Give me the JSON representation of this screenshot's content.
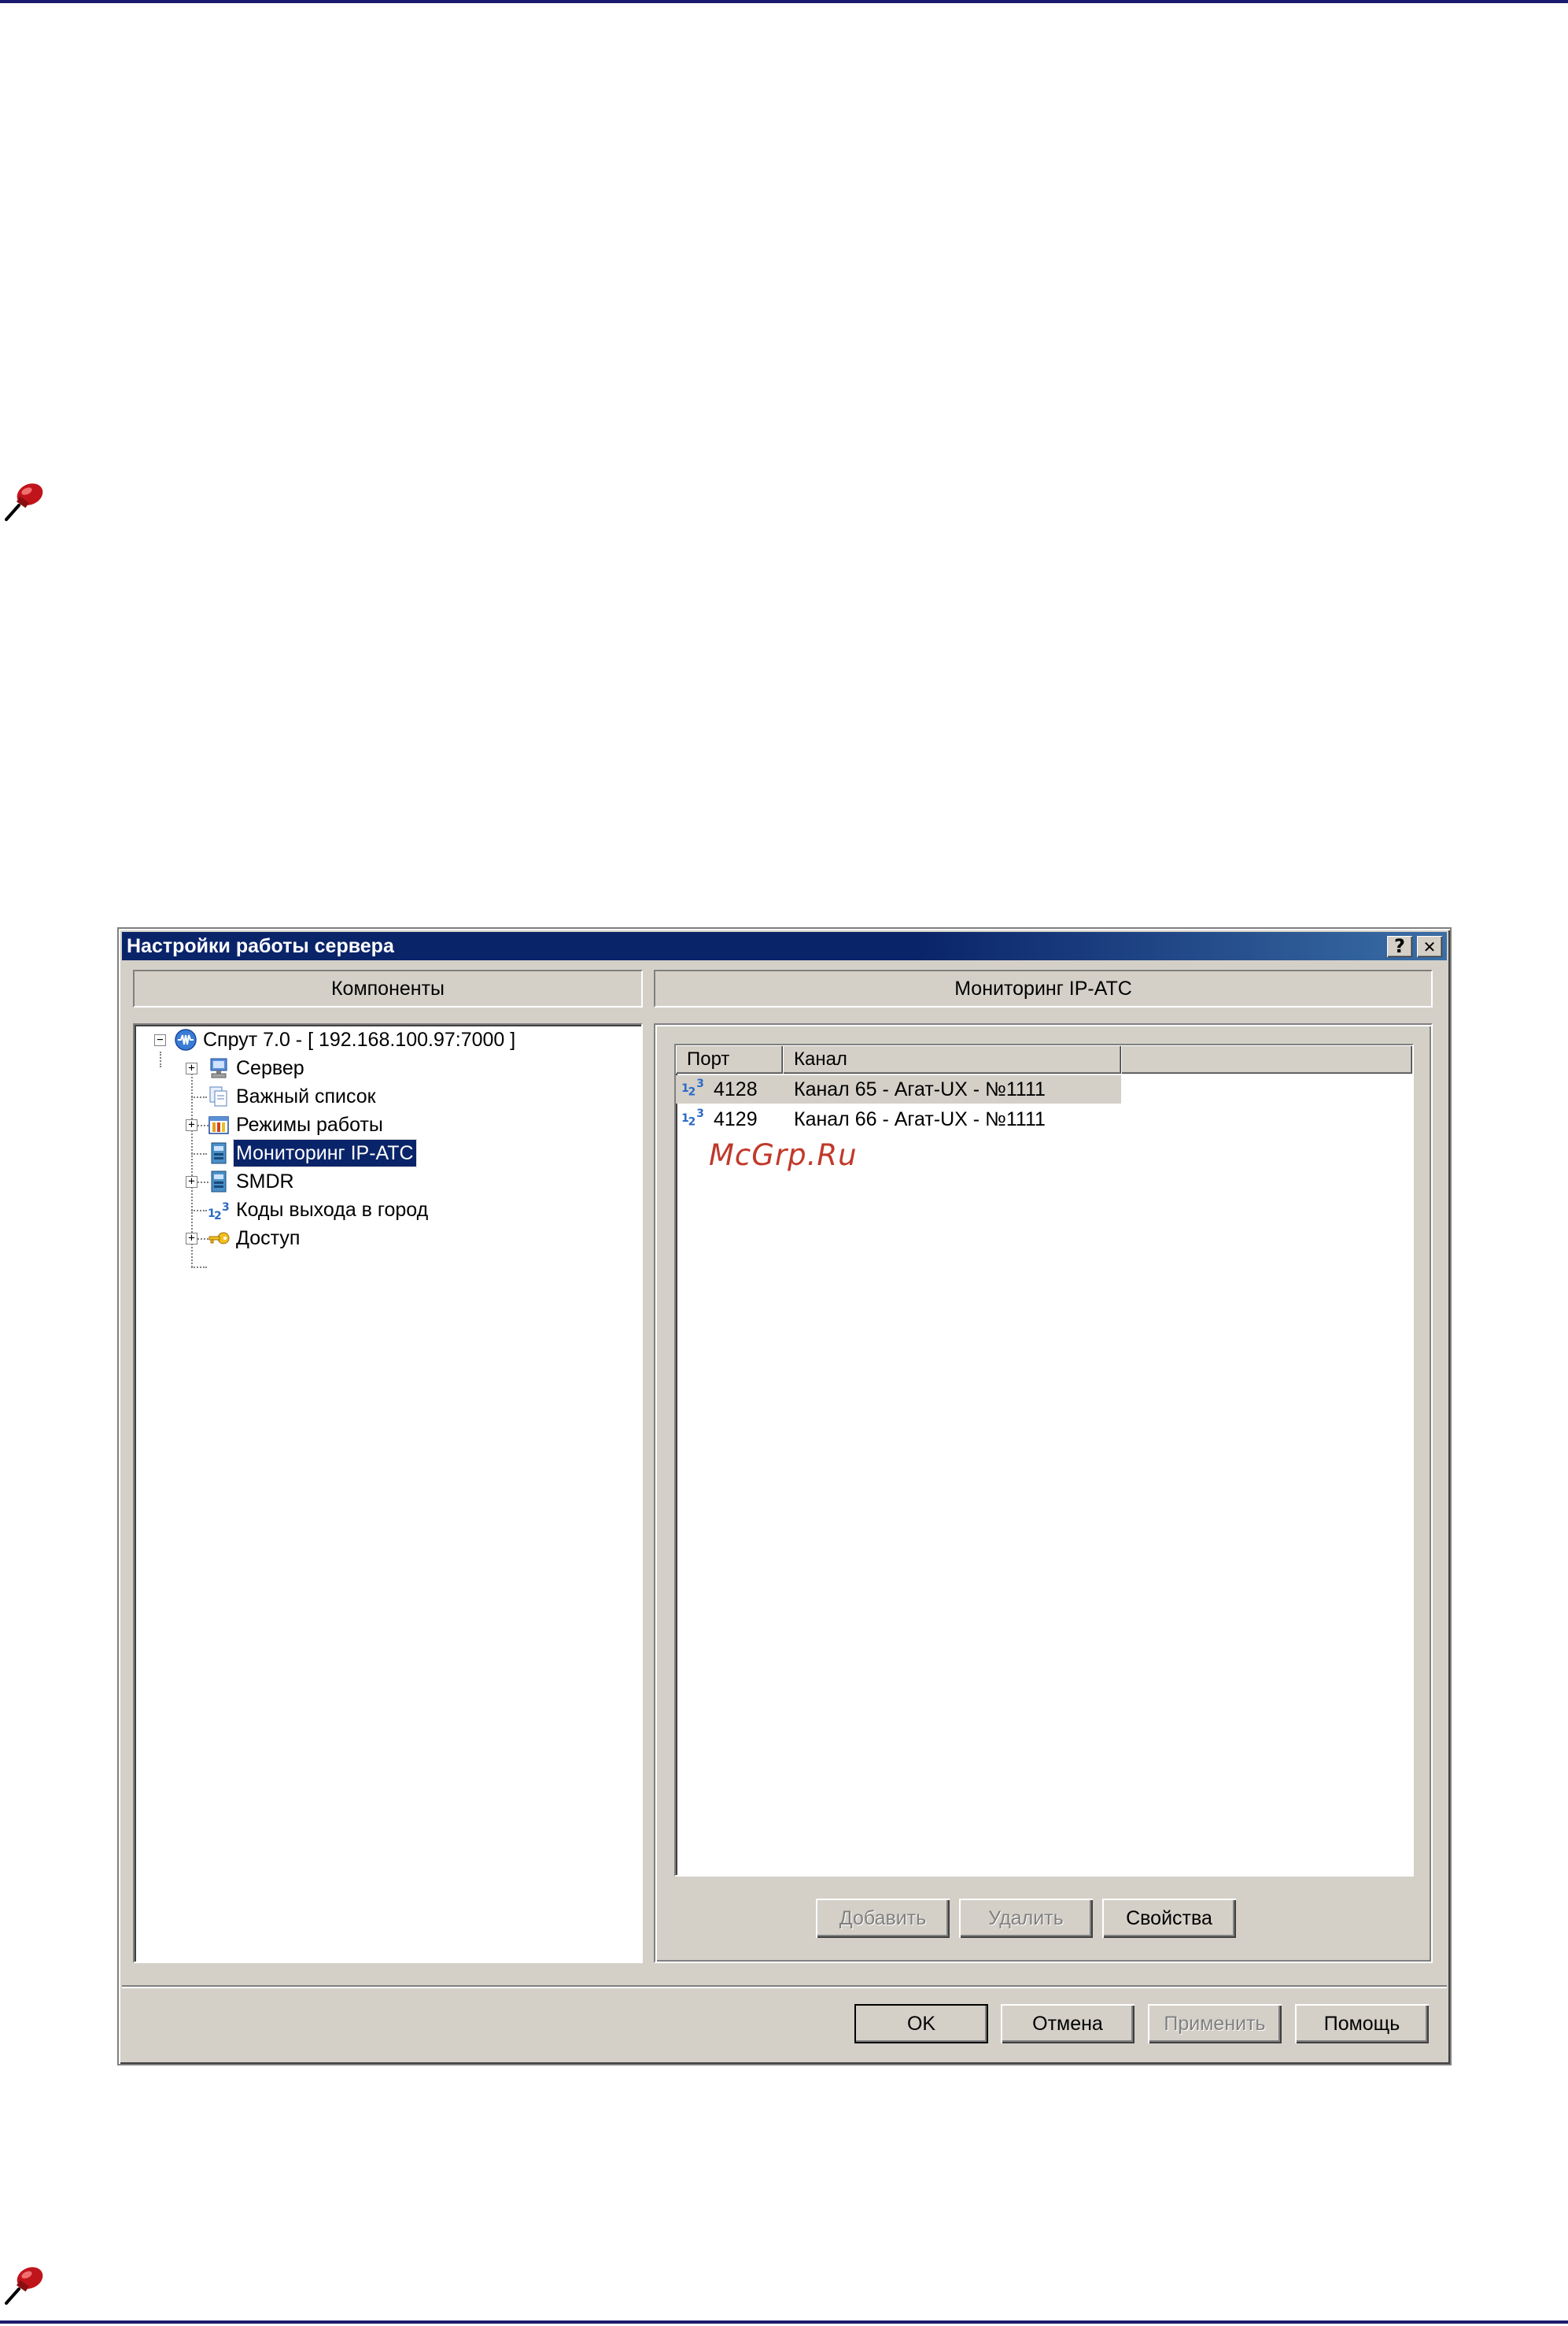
{
  "dialog": {
    "title": "Настройки работы сервера",
    "help_glyph": "?",
    "close_glyph": "✕"
  },
  "left_panel": {
    "header": "Компоненты",
    "tree": [
      {
        "label": "Спрут 7.0 - [ 192.168.100.97:7000 ]",
        "icon": "network-globe-icon",
        "expander": "−"
      },
      {
        "label": "Сервер",
        "icon": "server-computer-icon",
        "expander": "+"
      },
      {
        "label": "Важный список",
        "icon": "documents-icon"
      },
      {
        "label": "Режимы работы",
        "icon": "modes-calendar-icon",
        "expander": "+"
      },
      {
        "label": "Мониторинг IP-АТС",
        "icon": "device-icon",
        "selected": true
      },
      {
        "label": "SMDR",
        "icon": "device-icon",
        "expander": "+"
      },
      {
        "label": "Коды выхода в город",
        "icon": "numbers-123-icon"
      },
      {
        "label": "Доступ",
        "icon": "key-icon",
        "expander": "+"
      }
    ]
  },
  "right_panel": {
    "header": "Мониторинг IP-АТС",
    "columns": [
      "Порт",
      "Канал"
    ],
    "rows": [
      {
        "port": "4128",
        "channel": "Канал 65 - Агат-UX - №1111"
      },
      {
        "port": "4129",
        "channel": "Канал 66 - Агат-UX - №1111"
      }
    ],
    "watermark": "McGrp.Ru",
    "buttons": {
      "add": "Добавить",
      "delete": "Удалить",
      "properties": "Свойства"
    }
  },
  "footer_buttons": {
    "ok": "OK",
    "cancel": "Отмена",
    "apply": "Применить",
    "help": "Помощь"
  },
  "colors": {
    "titlebar": "#0a246a",
    "face": "#d4d0c8",
    "selection": "#0a246a",
    "rule": "#1c1a6e",
    "watermark": "#c0392b"
  }
}
